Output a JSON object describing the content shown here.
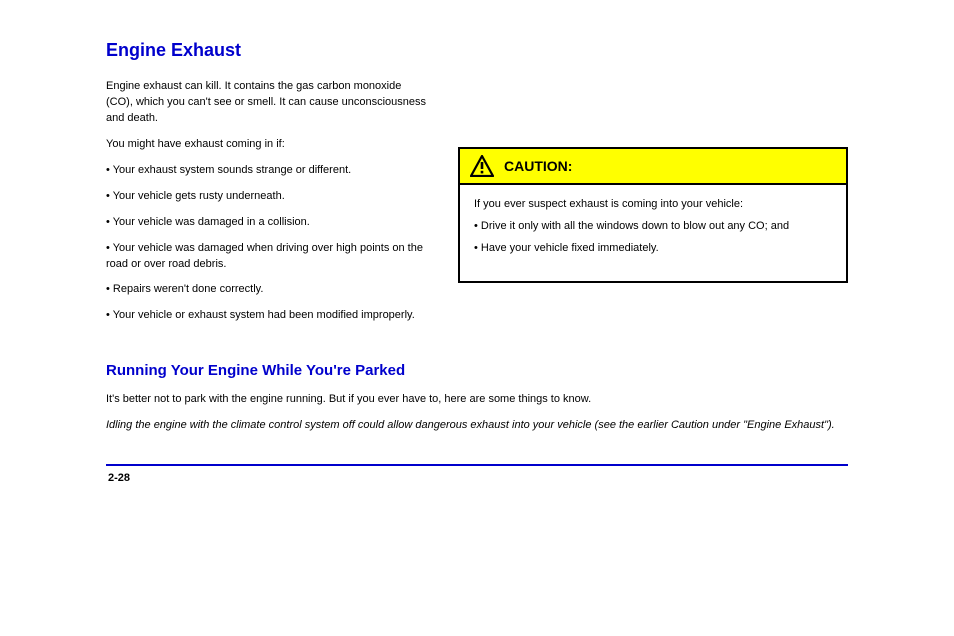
{
  "title": "Engine Exhaust",
  "left": {
    "p1": "Engine exhaust can kill. It contains the gas carbon monoxide (CO), which you can't see or smell. It can cause unconsciousness and death.",
    "p2": "You might have exhaust coming in if:",
    "bullets": [
      "Your exhaust system sounds strange or different.",
      "Your vehicle gets rusty underneath.",
      "Your vehicle was damaged in a collision.",
      "Your vehicle was damaged when driving over high points on the road or over road debris.",
      "Repairs weren't done correctly.",
      "Your vehicle or exhaust system had been modified improperly."
    ]
  },
  "caution": {
    "label": "CAUTION:",
    "p1": "If you ever suspect exhaust is coming into your vehicle:",
    "b1": "Drive it only with all the windows down to blow out any CO; and",
    "b2": "Have your vehicle fixed immediately."
  },
  "lower": {
    "h": "Running Your Engine While You're Parked",
    "p1": "It's better not to park with the engine running. But if you ever have to, here are some things to know.",
    "p2_em": "Idling the engine with the climate control system off could allow dangerous exhaust into your vehicle (see the earlier Caution under \"Engine Exhaust\")."
  },
  "footer": {
    "left": "2-28",
    "right": ""
  }
}
